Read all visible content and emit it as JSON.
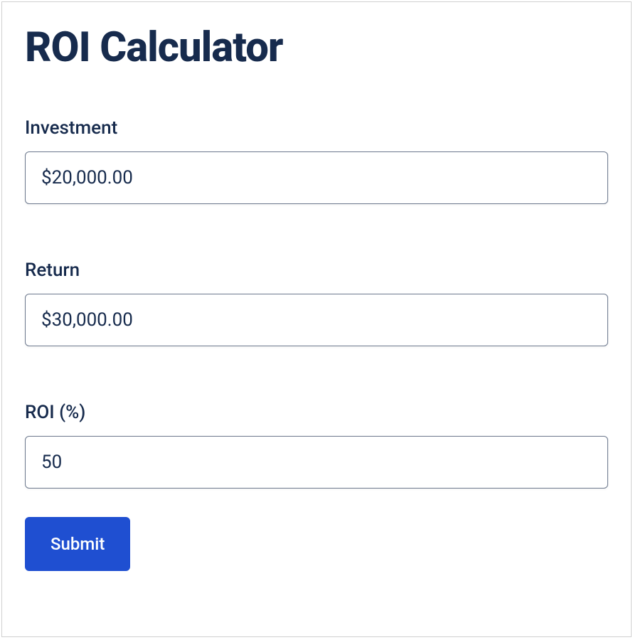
{
  "title": "ROI Calculator",
  "fields": {
    "investment": {
      "label": "Investment",
      "value": "$20,000.00"
    },
    "return": {
      "label": "Return",
      "value": "$30,000.00"
    },
    "roi": {
      "label": "ROI (%)",
      "value": "50"
    }
  },
  "submit_label": "Submit"
}
